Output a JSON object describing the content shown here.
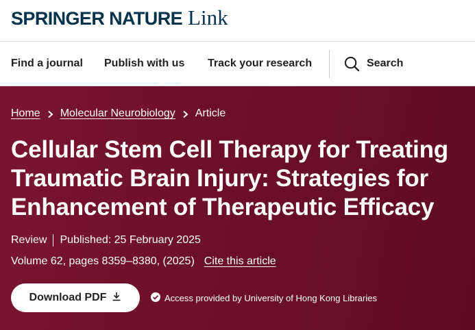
{
  "brand": {
    "springer_nature": "SPRINGER NATURE",
    "link": "Link",
    "color": "#01324b"
  },
  "nav": {
    "items": [
      {
        "label": "Find a journal"
      },
      {
        "label": "Publish with us"
      },
      {
        "label": "Track your research"
      }
    ],
    "search_label": "Search",
    "search_icon": "search-icon"
  },
  "breadcrumb": {
    "items": [
      {
        "label": "Home"
      },
      {
        "label": "Molecular Neurobiology"
      }
    ],
    "current": "Article",
    "separator_icon": "chevron-right-icon"
  },
  "article": {
    "title": "Cellular Stem Cell Therapy for Treating Traumatic Brain Injury: Strategies for Enhancement of Therapeutic Efficacy",
    "type": "Review",
    "published": "Published: 25 February 2025",
    "volume_info": "Volume 62, pages 8359–8380, (2025)",
    "cite_label": "Cite this article"
  },
  "actions": {
    "download_label": "Download PDF",
    "download_icon": "download-icon",
    "access_text": "Access provided by University of Hong Kong Libraries",
    "access_icon": "check-circle-icon"
  },
  "colors": {
    "hero_background": "#6c0f2a",
    "hero_text": "#ffffff"
  }
}
